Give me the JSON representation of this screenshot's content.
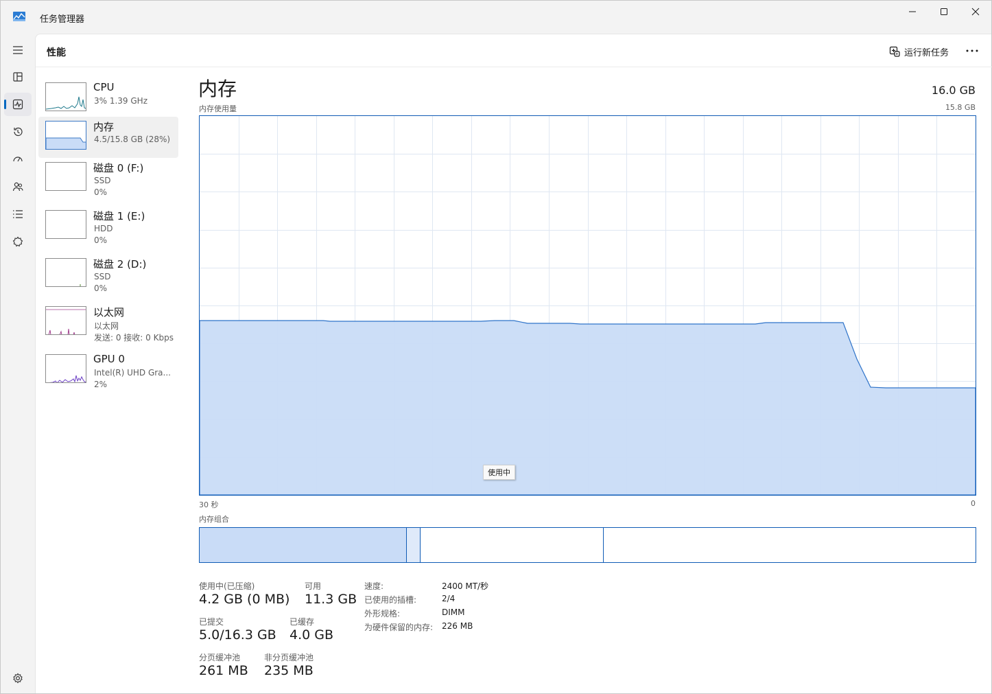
{
  "app": {
    "title": "任务管理器"
  },
  "header": {
    "page_title": "性能",
    "run_task_label": "运行新任务"
  },
  "nav": {
    "items": [
      "hamburger-icon",
      "processes-icon",
      "performance-icon",
      "app-history-icon",
      "startup-icon",
      "users-icon",
      "details-icon",
      "services-icon"
    ],
    "settings": "settings-icon"
  },
  "devices": [
    {
      "name": "CPU",
      "line1": "3% 1.39 GHz",
      "line2": ""
    },
    {
      "name": "内存",
      "line1": "4.5/15.8 GB (28%)",
      "line2": ""
    },
    {
      "name": "磁盘 0 (F:)",
      "line1": "SSD",
      "line2": "0%"
    },
    {
      "name": "磁盘 1 (E:)",
      "line1": "HDD",
      "line2": "0%"
    },
    {
      "name": "磁盘 2 (D:)",
      "line1": "SSD",
      "line2": "0%"
    },
    {
      "name": "以太网",
      "line1": "以太网",
      "line2": "发送: 0 接收: 0 Kbps"
    },
    {
      "name": "GPU 0",
      "line1": "Intel(R) UHD Gra...",
      "line2": "2%"
    }
  ],
  "memory": {
    "title": "内存",
    "total": "16.0 GB",
    "usage_label": "内存使用量",
    "usage_max": "15.8 GB",
    "x_left": "30 秒",
    "x_right": "0",
    "tooltip": "使用中",
    "composition_label": "内存组合",
    "stats": {
      "in_use_label": "使用中(已压缩)",
      "in_use_value": "4.2 GB (0 MB)",
      "available_label": "可用",
      "available_value": "11.3 GB",
      "committed_label": "已提交",
      "committed_value": "5.0/16.3 GB",
      "cached_label": "已缓存",
      "cached_value": "4.0 GB",
      "paged_label": "分页缓冲池",
      "paged_value": "261 MB",
      "nonpaged_label": "非分页缓冲池",
      "nonpaged_value": "235 MB"
    },
    "specs": [
      {
        "key": "速度:",
        "value": "2400 MT/秒"
      },
      {
        "key": "已使用的插槽:",
        "value": "2/4"
      },
      {
        "key": "外形规格:",
        "value": "DIMM"
      },
      {
        "key": "为硬件保留的内存:",
        "value": "226 MB"
      }
    ]
  },
  "colors": {
    "accent": "#0f5bb5",
    "fill": "#c9dcf7",
    "grid": "#dfe7f2"
  }
}
